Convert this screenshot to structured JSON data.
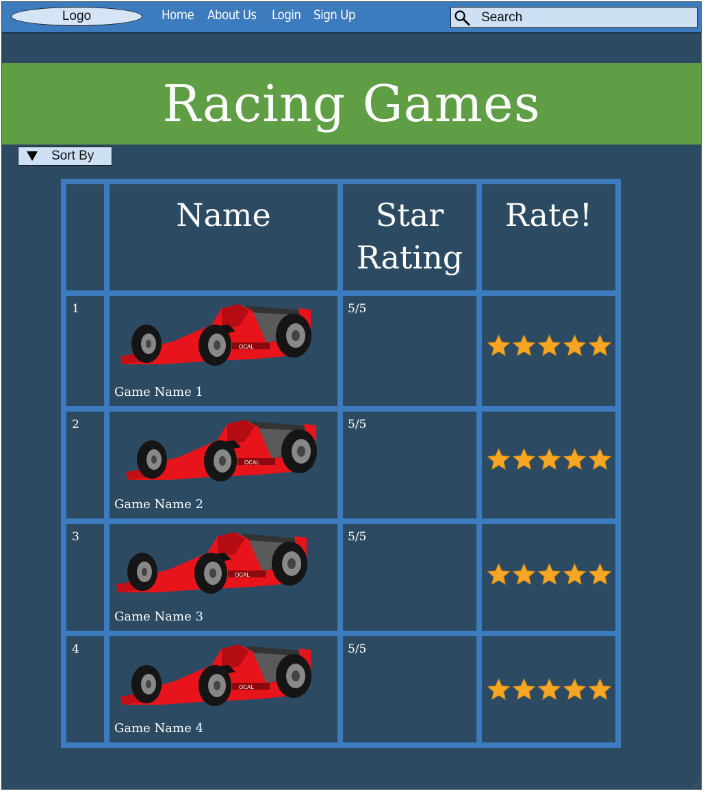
{
  "nav": {
    "logo": "Logo",
    "links": [
      "Home",
      "About Us",
      "Login",
      "Sign Up"
    ],
    "search_placeholder": "Search",
    "search_icon": "search-icon"
  },
  "hero": {
    "title": "Racing Games"
  },
  "sort": {
    "label": "Sort By",
    "icon": "triangle-down-icon"
  },
  "table": {
    "headers": [
      "",
      "Name",
      "Star Rating",
      "Rate!"
    ],
    "rows": [
      {
        "rank": "1",
        "name": "Game Name 1",
        "rating": "5/5",
        "rate_stars": 5
      },
      {
        "rank": "2",
        "name": "Game Name 2",
        "rating": "5/5",
        "rate_stars": 5
      },
      {
        "rank": "3",
        "name": "Game Name 3",
        "rating": "5/5",
        "rate_stars": 5
      },
      {
        "rank": "4",
        "name": "Game Name 4",
        "rating": "5/5",
        "rate_stars": 5
      }
    ]
  },
  "colors": {
    "nav_bg": "#3c7bbd",
    "page_bg": "#2c4b63",
    "hero_bg": "#5f9e45",
    "star": "#f6a623",
    "car": "#e8141c"
  }
}
